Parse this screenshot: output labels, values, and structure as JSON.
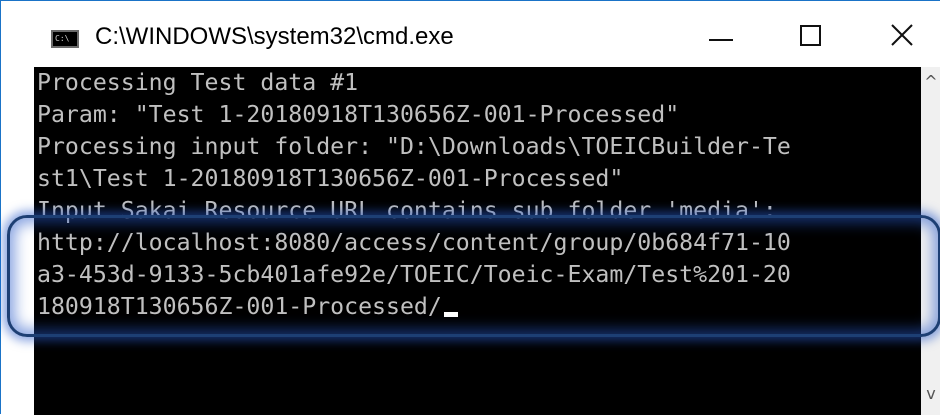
{
  "window": {
    "title": "C:\\WINDOWS\\system32\\cmd.exe",
    "icon": "cmd-app-icon",
    "icon_text": "C:\\",
    "controls": {
      "minimize": "minimize-icon",
      "maximize": "maximize-icon",
      "close": "close-icon"
    }
  },
  "console": {
    "background": "#000000",
    "foreground": "#c0c0c0",
    "lines": [
      "Processing Test data #1",
      "Param: \"Test 1-20180918T130656Z-001-Processed\"",
      "Processing input folder: \"D:\\Downloads\\TOEICBuilder-Te",
      "st1\\Test 1-20180918T130656Z-001-Processed\"",
      "Input Sakai Resource URL contains sub folder 'media':",
      "http://localhost:8080/access/content/group/0b684f71-10",
      "a3-453d-9133-5cb401afe92e/TOEIC/Toeic-Exam/Test%201-20",
      "180918T130656Z-001-Processed/"
    ]
  },
  "scrollbar": {
    "up": "^",
    "down": "v"
  },
  "highlight_color": "#1d3f74"
}
